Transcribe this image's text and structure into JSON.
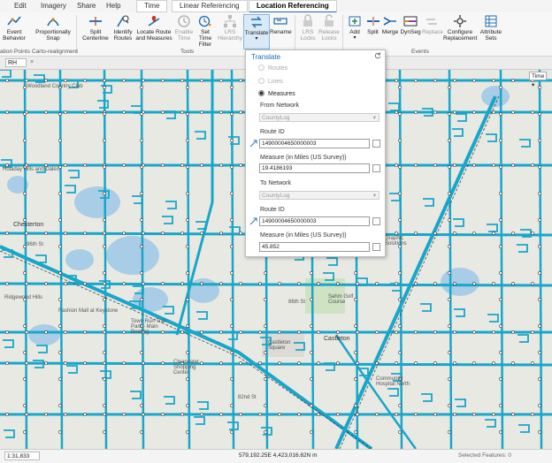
{
  "menubar": {
    "items": [
      "Edit",
      "Imagery",
      "Share",
      "Help",
      "Time",
      "Linear Referencing",
      "Location Referencing"
    ],
    "active": "Location Referencing"
  },
  "ribbon": {
    "buttons": {
      "event_behavior": "Event Behavior",
      "proportionally_snap": "Proportionally Snap",
      "split_centerline": "Split Centerline",
      "identify_routes": "Identify Routes",
      "locate_route": "Locate Route and Measures",
      "enable_time": "Enable Time",
      "set_time_filter": "Set Time Filter",
      "lrs_hierarchy": "LRS Hierarchy",
      "translate": "Translate",
      "rename": "Rename",
      "lrs_locks": "LRS Locks",
      "release_locks": "Release Locks",
      "add": "Add",
      "split": "Split",
      "merge": "Merge",
      "dynseg": "DynSeg",
      "replace": "Replace",
      "configure_replacement": "Configure Replacement",
      "attribute_sets": "Attribute Sets"
    },
    "groups": {
      "location_points": "ation Points",
      "carto_realignment": "Carto-realignment",
      "tools": "Tools",
      "events": "Events"
    }
  },
  "viewtab": {
    "tab_name": "RH",
    "time_button": "Time"
  },
  "translate_panel": {
    "title": "Translate",
    "options": {
      "routes": "Routes",
      "lines": "Lines",
      "measures": "Measures"
    },
    "selected": "Measures",
    "from_network_label": "From Network",
    "from_network_value": "CountyLog",
    "route_id_label_1": "Route ID",
    "route_id_value_1": "14900004650000003",
    "measure_label_1": "Measure (in Miles (US Survey))",
    "measure_value_1": "19.4186193",
    "to_network_label": "To Network",
    "to_network_value": "CountyLog",
    "route_id_label_2": "Route ID",
    "route_id_value_2": "14900004650000003",
    "measure_label_2": "Measure (in Miles (US Survey))",
    "measure_value_2": "45.852"
  },
  "map_labels": {
    "woodland_cc": "Woodland Country Club",
    "holaday_hills": "Holaday Hills and Dales",
    "chesterton": "Chesterton",
    "ridgewood_hills": "Ridgewood Hills",
    "fashion_mall": "Fashion Mall at Keystone",
    "town_run": "Town Run Trail Park - Main Boating",
    "sahm_golf": "Sahm Golf Course",
    "castleton_square": "Castleton Square",
    "castleton": "Castleton",
    "clearwater": "Clearwater Shopping Center",
    "community_hospital": "Community Hospital North",
    "graphic_solutions": "Graphic Solutions",
    "road_96": "96th St",
    "road_86": "86th St",
    "road_82": "82nd St"
  },
  "status": {
    "scale": "1:31,833",
    "coordinates": "579,192.25E 4,423,016.82N m",
    "selected_features": "Selected Features: 0"
  },
  "colors": {
    "accent": "#1c6bb0",
    "routes": "#18a6c9",
    "map_bg": "#e9e9e4",
    "water": "#a9cde6"
  }
}
